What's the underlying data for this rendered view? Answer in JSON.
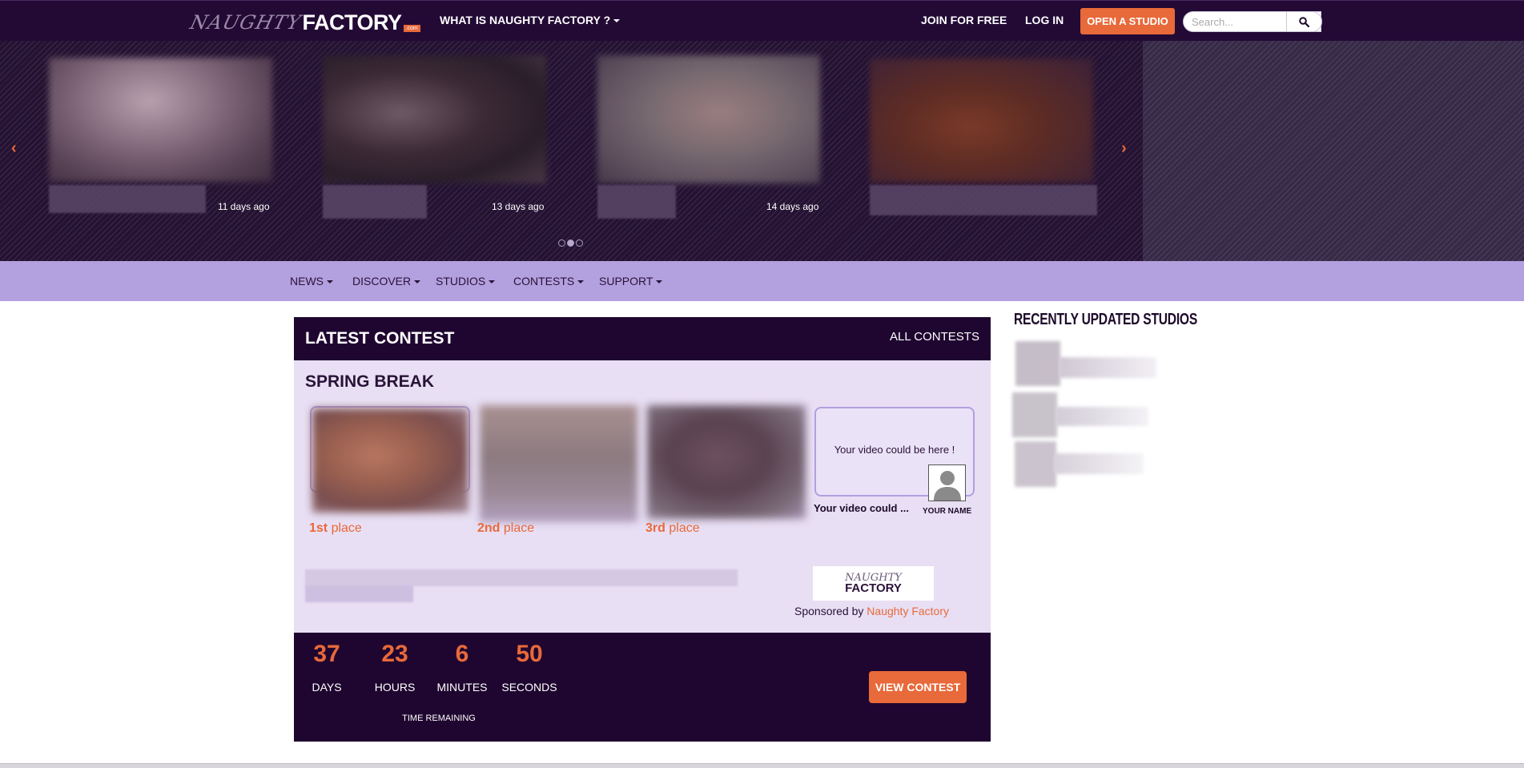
{
  "header": {
    "logo_naughty": "NAUGHTY",
    "logo_factory": "FACTORY",
    "logo_com": ".com",
    "what_is": "WHAT IS NAUGHTY FACTORY ?",
    "join": "JOIN FOR FREE",
    "login": "LOG IN",
    "open_studio": "OPEN A STUDIO",
    "search_placeholder": "Search..."
  },
  "carousel": {
    "slides": [
      {
        "ago": "11 days ago"
      },
      {
        "ago": "13 days ago"
      },
      {
        "ago": "14 days ago"
      },
      {
        "ago": ""
      }
    ],
    "dots": 3,
    "active_dot": 1
  },
  "subnav": {
    "items": [
      "NEWS",
      "DISCOVER",
      "STUDIOS",
      "CONTESTS",
      "SUPPORT"
    ]
  },
  "contest": {
    "heading": "LATEST CONTEST",
    "all_contests": "ALL CONTESTS",
    "name": "SPRING BREAK",
    "places": [
      {
        "num": "1st",
        "word": "place"
      },
      {
        "num": "2nd",
        "word": "place"
      },
      {
        "num": "3rd",
        "word": "place"
      }
    ],
    "placeholder_text": "Your video could be here !",
    "placeholder_title": "Your video could ...",
    "your_name": "YOUR NAME",
    "sponsor_prefix": "Sponsored by",
    "sponsor_name": "Naughty Factory",
    "sponsor_logo_top": "NAUGHTY",
    "sponsor_logo_bottom": "FACTORY",
    "countdown": {
      "days": "37",
      "days_label": "DAYS",
      "hours": "23",
      "hours_label": "HOURS",
      "minutes": "6",
      "minutes_label": "MINUTES",
      "seconds": "50",
      "seconds_label": "SECONDS",
      "caption": "TIME REMAINING"
    },
    "view_button": "VIEW CONTEST"
  },
  "sidebar": {
    "title": "RECENTLY UPDATED STUDIOS"
  },
  "colors": {
    "nav_bg": "#230a35",
    "accent": "#e8693a",
    "subnav_bg": "#b3a0df",
    "panel_bg": "#e8dff4"
  }
}
